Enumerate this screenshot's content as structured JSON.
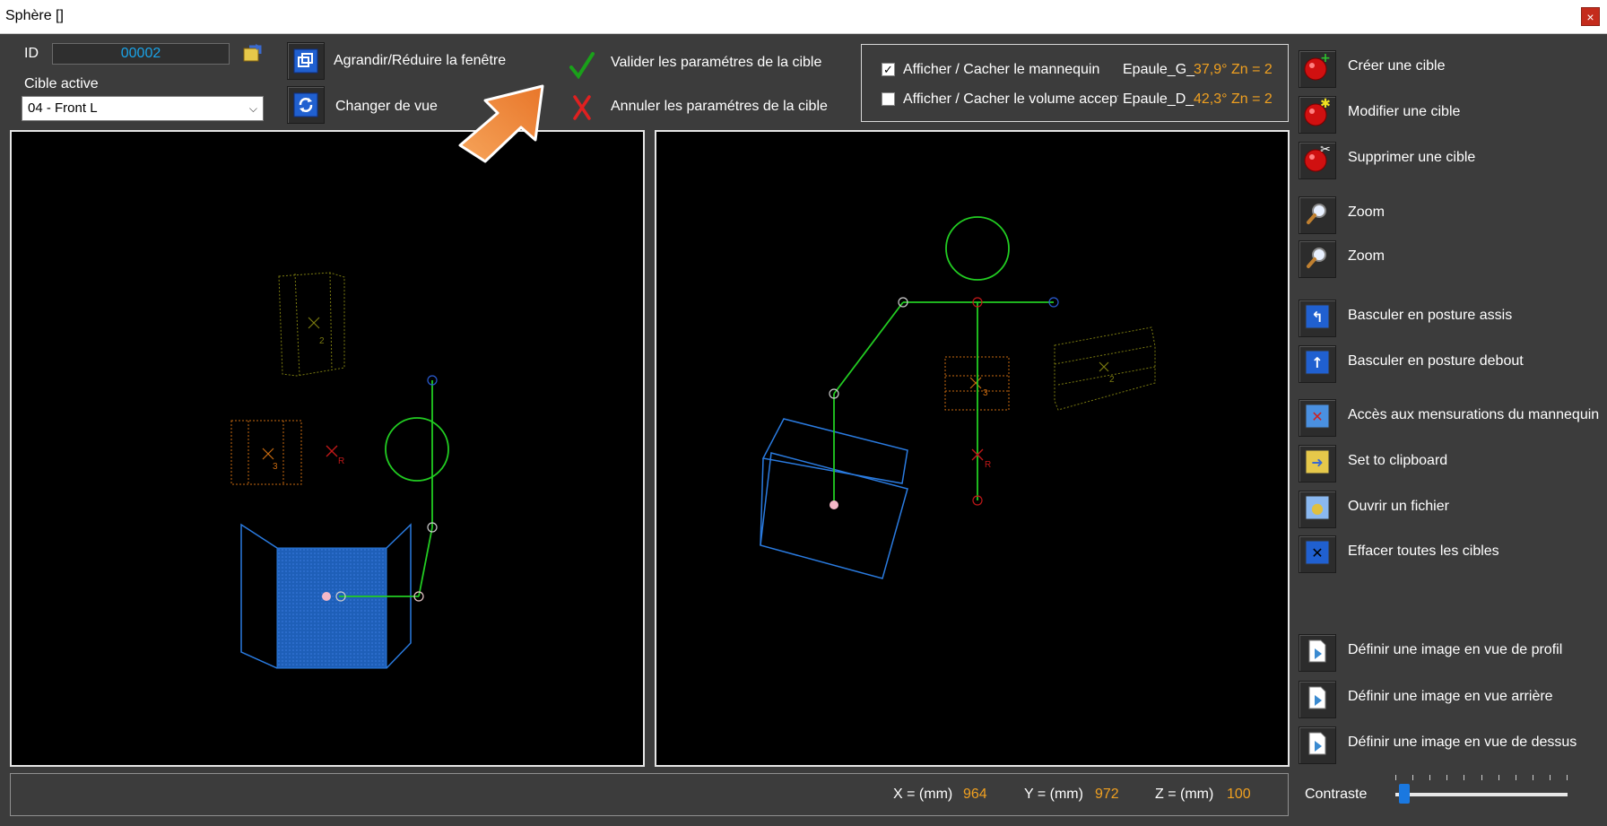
{
  "window": {
    "title": "Sphère []",
    "close_symbol": "×"
  },
  "id_field": {
    "label": "ID",
    "value": "00002"
  },
  "cible_active": {
    "label": "Cible active",
    "selected": "04 - Front L"
  },
  "toolbar": {
    "resize_label": "Agrandir/Réduire la fenêtre",
    "view_label": "Changer de vue",
    "validate_label": "Valider les paramétres de la cible",
    "cancel_label": "Annuler les paramétres de la cible"
  },
  "display_options": {
    "mannequin": {
      "label": "Afficher / Cacher le mannequin",
      "checked": true
    },
    "volume": {
      "label": "Afficher / Cacher le volume accepta",
      "checked": false
    },
    "epaule_g": {
      "label": "Epaule_G_",
      "value": "37,9° Zn = 2"
    },
    "epaule_d": {
      "label": "Epaule_D_",
      "value": "42,3° Zn = 2"
    }
  },
  "sidebar": {
    "items": [
      {
        "label": "Créer une cible",
        "icon": "create-target-icon"
      },
      {
        "label": "Modifier une cible",
        "icon": "edit-target-icon"
      },
      {
        "label": "Supprimer une cible",
        "icon": "delete-target-icon"
      },
      {
        "label": "Zoom",
        "icon": "zoom-in-icon"
      },
      {
        "label": "Zoom",
        "icon": "zoom-out-icon"
      },
      {
        "label": "Basculer en posture assis",
        "icon": "sit-posture-icon"
      },
      {
        "label": "Basculer en posture debout",
        "icon": "stand-posture-icon"
      },
      {
        "label": "Accès aux mensurations du mannequin",
        "icon": "measurements-icon"
      },
      {
        "label": "Set to clipboard",
        "icon": "clipboard-icon"
      },
      {
        "label": "Ouvrir un fichier",
        "icon": "open-file-icon"
      },
      {
        "label": "Effacer toutes les cibles",
        "icon": "clear-targets-icon"
      },
      {
        "label": "Définir une image en vue de profil",
        "icon": "profile-image-icon"
      },
      {
        "label": "Définir une image en vue arrière",
        "icon": "rear-image-icon"
      },
      {
        "label": "Définir une image en vue de dessus",
        "icon": "top-image-icon"
      }
    ]
  },
  "viewport_labels": {
    "left_target_2": "2",
    "left_target_3": "3",
    "left_r": "R",
    "right_target_3": "3",
    "right_target_2": "2",
    "right_r": "R"
  },
  "status": {
    "x_label": "X = (mm)",
    "x_value": "964",
    "y_label": "Y = (mm)",
    "y_value": "972",
    "z_label": "Z = (mm)",
    "z_value": "100"
  },
  "contrast": {
    "label": "Contraste",
    "level": 0.02
  },
  "colors": {
    "accent_orange": "#f0a020",
    "id_blue": "#1aa3e8",
    "skeleton_green": "#22cc22",
    "blue_box": "#2a7be0",
    "target_orange": "#c86a10",
    "target_olive": "#7a7a10",
    "marker_red": "#c01818",
    "callout_arrow": "#f08a30"
  }
}
